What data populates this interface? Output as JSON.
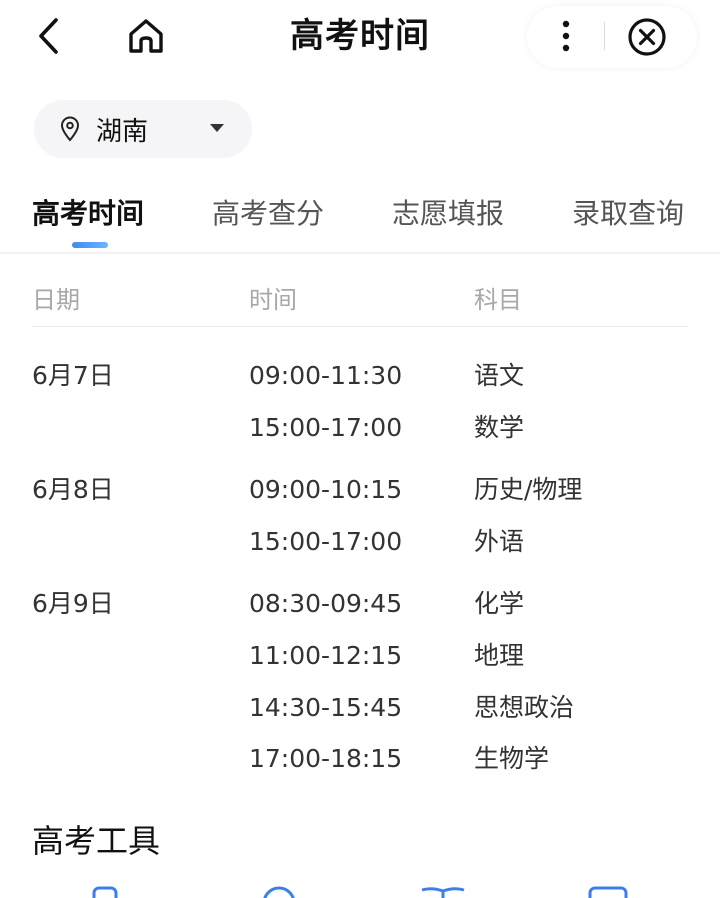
{
  "header": {
    "title": "高考时间",
    "back_icon": "chevron-left-icon",
    "home_icon": "home-icon",
    "more_icon": "more-vertical-icon",
    "close_icon": "close-circle-icon"
  },
  "region": {
    "label": "湖南",
    "icon": "location-pin-icon"
  },
  "tabs": [
    {
      "label": "高考时间",
      "active": true
    },
    {
      "label": "高考查分",
      "active": false
    },
    {
      "label": "志愿填报",
      "active": false
    },
    {
      "label": "录取查询",
      "active": false
    }
  ],
  "schedule": {
    "columns": [
      "日期",
      "时间",
      "科目"
    ],
    "rows": [
      {
        "date": "6月7日",
        "time": "09:00-11:30",
        "subject": "语文"
      },
      {
        "date": "",
        "time": "15:00-17:00",
        "subject": "数学"
      },
      {
        "date": "6月8日",
        "time": "09:00-10:15",
        "subject": "历史/物理"
      },
      {
        "date": "",
        "time": "15:00-17:00",
        "subject": "外语"
      },
      {
        "date": "6月9日",
        "time": "08:30-09:45",
        "subject": "化学"
      },
      {
        "date": "",
        "time": "11:00-12:15",
        "subject": "地理"
      },
      {
        "date": "",
        "time": "14:30-15:45",
        "subject": "思想政治"
      },
      {
        "date": "",
        "time": "17:00-18:15",
        "subject": "生物学"
      }
    ]
  },
  "tools": {
    "title": "高考工具"
  },
  "colors": {
    "accent": "#3a8cf0",
    "accent_gradient_end": "#6fb3ff",
    "text_primary": "#111111",
    "text_secondary": "#555555",
    "text_muted": "#a8a8a8",
    "tool_icon": "#3d7fe8"
  }
}
